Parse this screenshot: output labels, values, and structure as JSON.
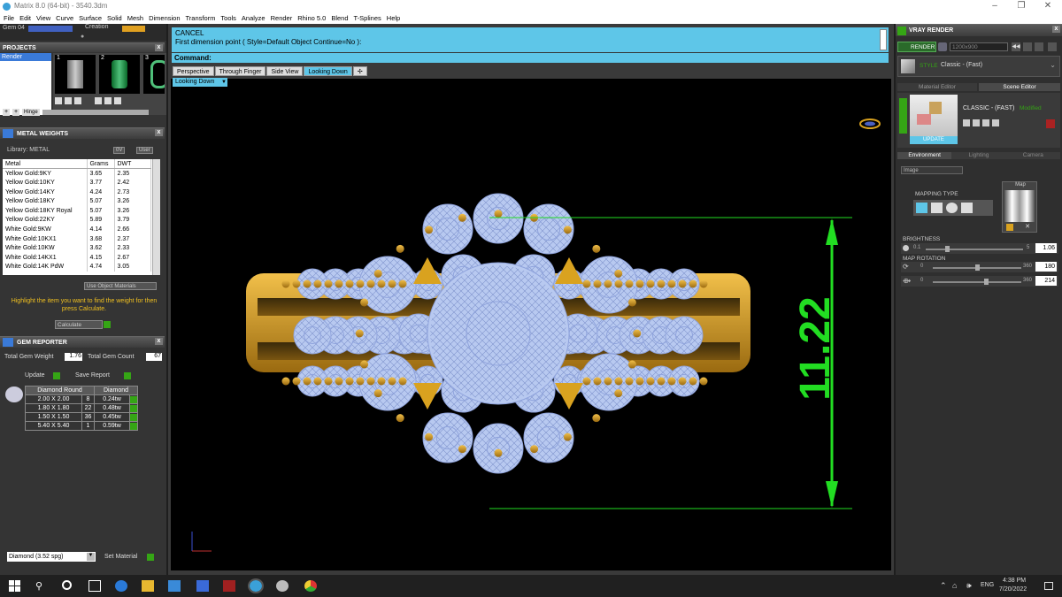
{
  "titlebar": {
    "title": "Matrix 8.0 (64-bit) - 3540.3dm"
  },
  "menu": [
    "File",
    "Edit",
    "View",
    "Curve",
    "Surface",
    "Solid",
    "Mesh",
    "Dimension",
    "Transform",
    "Tools",
    "Analyze",
    "Render",
    "Rhino 5.0",
    "Blend",
    "T-Splines",
    "Help"
  ],
  "toolbar_row": {
    "gem_label": "Gem 04",
    "creation_label": "Creation"
  },
  "projects": {
    "title": "PROJECTS",
    "item": "Render",
    "thumb_numbers": [
      "1",
      "2",
      "3"
    ],
    "hinge_label": "Hinge"
  },
  "metal_weights": {
    "title": "METAL WEIGHTS",
    "library_label": "Library: METAL",
    "unit_label": "0V",
    "user_label": "User",
    "columns": [
      "Metal",
      "Grams",
      "DWT"
    ],
    "rows": [
      [
        "Yellow Gold:9KY",
        "3.65",
        "2.35"
      ],
      [
        "Yellow Gold:10KY",
        "3.77",
        "2.42"
      ],
      [
        "Yellow Gold:14KY",
        "4.24",
        "2.73"
      ],
      [
        "Yellow Gold:18KY",
        "5.07",
        "3.26"
      ],
      [
        "Yellow Gold:18KY Royal",
        "5.07",
        "3.26"
      ],
      [
        "Yellow Gold:22KY",
        "5.89",
        "3.79"
      ],
      [
        "White Gold:9KW",
        "4.14",
        "2.66"
      ],
      [
        "White Gold:10KX1",
        "3.68",
        "2.37"
      ],
      [
        "White Gold:10KW",
        "3.62",
        "2.33"
      ],
      [
        "White Gold:14KX1",
        "4.15",
        "2.67"
      ],
      [
        "White Gold:14K PdW",
        "4.74",
        "3.05"
      ]
    ],
    "use_object_materials": "Use Object Materials",
    "hint": "Highlight the item you want to find the weight for then press Calculate.",
    "calculate": "Calculate"
  },
  "gem_reporter": {
    "title": "GEM REPORTER",
    "total_weight_label": "Total Gem Weight",
    "total_weight": "1.76",
    "total_count_label": "Total Gem Count",
    "total_count": "67",
    "update": "Update",
    "save_report": "Save Report",
    "columns": [
      "Diamond Round",
      "Diamond"
    ],
    "rows": [
      [
        "2.00 X 2.00",
        "8",
        "0.24tw"
      ],
      [
        "1.80 X 1.80",
        "22",
        "0.48tw"
      ],
      [
        "1.50 X 1.50",
        "36",
        "0.45tw"
      ],
      [
        "5.40 X 5.40",
        "1",
        "0.59tw"
      ]
    ],
    "material_select": "Diamond      (3.52 spg)",
    "set_material": "Set Material"
  },
  "command": {
    "line1": "CANCEL",
    "line2": "First dimension point ( Style=Default  Object  Continue=No ):",
    "prompt": "Command:"
  },
  "viewport_tabs": [
    "Perspective",
    "Through Finger",
    "Side View",
    "Looking Down"
  ],
  "active_viewport": "Looking Down",
  "dimension_value": "11.22",
  "vray": {
    "title": "VRAY RENDER",
    "render_btn": "RENDER",
    "resolution": "1200x900",
    "style_label": "STYLE",
    "style_value": "Classic - (Fast)",
    "tabs": [
      "Material Editor",
      "Scene Editor"
    ],
    "scene_name": "CLASSIC - (FAST)",
    "modified": "Modified",
    "update": "UPDATE",
    "env_tabs": [
      "Environment",
      "Lighting",
      "Camera"
    ],
    "env_select": "Image",
    "mapping_type": "MAPPING TYPE",
    "map_label": "Map",
    "brightness_label": "BRIGHTNESS",
    "brightness_min": "0.1",
    "brightness_max": "5",
    "brightness_value": "1.06",
    "rotation_label": "MAP ROTATION",
    "rot1_min": "0",
    "rot1_max": "360",
    "rot1_value": "180",
    "rot2_min": "0",
    "rot2_max": "360",
    "rot2_value": "214"
  },
  "taskbar": {
    "lang": "ENG",
    "time": "4:38 PM",
    "date": "7/20/2022"
  },
  "colors": {
    "accent": "#5ec6e8",
    "dimension": "#22dd22",
    "gold": "#d9a21f",
    "diamond": "#b8c9f0"
  }
}
